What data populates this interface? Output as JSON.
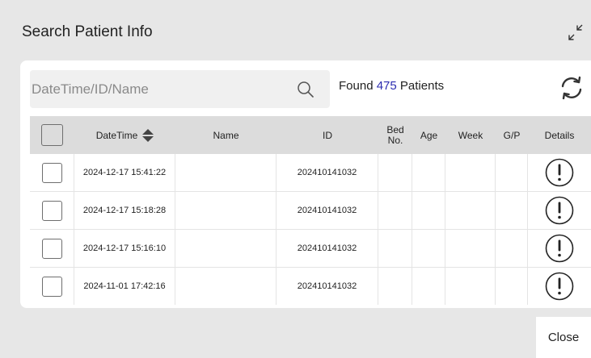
{
  "dialog": {
    "title": "Search Patient Info",
    "close_label": "Close"
  },
  "search": {
    "placeholder": "DateTime/ID/Name",
    "value": ""
  },
  "found": {
    "prefix": "Found",
    "count": "475",
    "suffix": "Patients"
  },
  "table": {
    "headers": {
      "datetime": "DateTime",
      "name": "Name",
      "id": "ID",
      "bed_line1": "Bed",
      "bed_line2": "No.",
      "age": "Age",
      "week": "Week",
      "gp": "G/P",
      "details": "Details"
    },
    "rows": [
      {
        "datetime": "2024-12-17 15:41:22",
        "name": "",
        "id": "202410141032",
        "bed": "",
        "age": "",
        "week": "",
        "gp": ""
      },
      {
        "datetime": "2024-12-17 15:18:28",
        "name": "",
        "id": "202410141032",
        "bed": "",
        "age": "",
        "week": "",
        "gp": ""
      },
      {
        "datetime": "2024-12-17 15:16:10",
        "name": "",
        "id": "202410141032",
        "bed": "",
        "age": "",
        "week": "",
        "gp": ""
      },
      {
        "datetime": "2024-11-01 17:42:16",
        "name": "",
        "id": "202410141032",
        "bed": "",
        "age": "",
        "week": "",
        "gp": ""
      }
    ]
  },
  "colors": {
    "background": "#e7e7e7",
    "card": "#ffffff",
    "header_row": "#dcdcdc",
    "count_accent": "#2c2cb0"
  },
  "icons": {
    "collapse": "collapse-arrows-icon",
    "search": "magnifier-icon",
    "refresh": "refresh-icon",
    "sort": "sort-icon",
    "details": "info-exclamation-icon"
  }
}
